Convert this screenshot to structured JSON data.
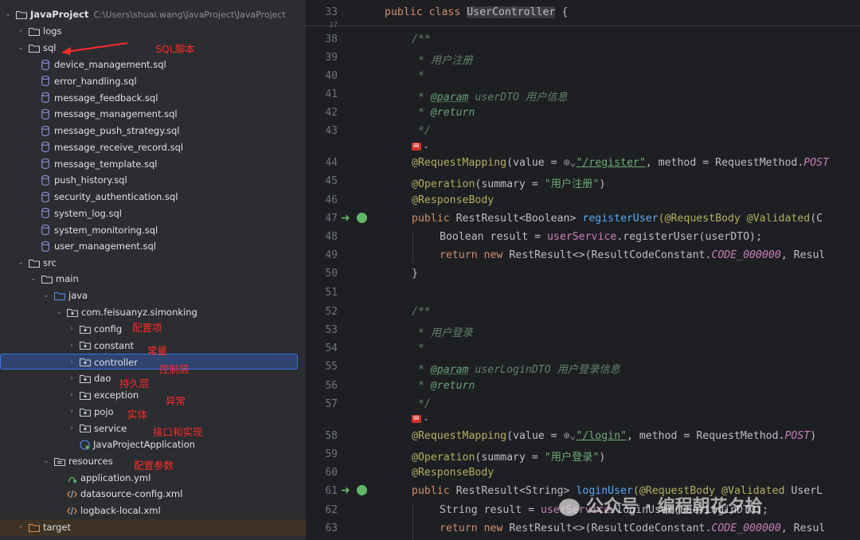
{
  "project": {
    "name": "JavaProject",
    "path": "C:\\Users\\shuai.wang\\JavaProject\\JavaProject"
  },
  "tree": {
    "logs": "logs",
    "sql": "sql",
    "sql_files": [
      "device_management.sql",
      "error_handling.sql",
      "message_feedback.sql",
      "message_management.sql",
      "message_push_strategy.sql",
      "message_receive_record.sql",
      "message_template.sql",
      "push_history.sql",
      "security_authentication.sql",
      "system_log.sql",
      "system_monitoring.sql",
      "user_management.sql"
    ],
    "src": "src",
    "main": "main",
    "java": "java",
    "package": "com.feisuanyz.simonking",
    "packages": [
      "config",
      "constant",
      "controller",
      "dao",
      "exception",
      "pojo",
      "service"
    ],
    "app_class": "JavaProjectApplication",
    "resources": "resources",
    "resource_files": [
      "application.yml",
      "datasource-config.xml",
      "logback-local.xml"
    ],
    "target": "target"
  },
  "annotations": {
    "sql": "SQL脚本",
    "config": "配置项",
    "constant": "常量",
    "controller": "控制层",
    "dao": "持久层",
    "exception": "异常",
    "pojo": "实体",
    "service": "接口和实现",
    "resources": "配置参数"
  },
  "editor": {
    "line_numbers": [
      "33",
      "37",
      "38",
      "39",
      "40",
      "41",
      "42",
      "43",
      "44",
      "45",
      "46",
      "47",
      "48",
      "49",
      "50",
      "51",
      "52",
      "53",
      "54",
      "55",
      "56",
      "57",
      "58",
      "59",
      "60",
      "61",
      "62",
      "63"
    ],
    "lines": {
      "l33": {
        "kw": "public class ",
        "name": "UserController",
        "rest": " {"
      },
      "l38": "/**",
      "l39": " * 用户注册",
      "l40": " *",
      "l41_tag": "@param",
      "l41_rest": " userDTO 用户信息",
      "l42_tag": "@return",
      "l43": " */",
      "l44_pre": "@RequestMapping",
      "l44_mid": "(value = ",
      "l44_str": "\"/register\"",
      "l44_post": ", method = RequestMethod.",
      "l44_const": "POST",
      "l45_pre": "@Operation",
      "l45_mid": "(summary = ",
      "l45_str": "\"用户注册\"",
      "l45_post": ")",
      "l46": "@ResponseBody",
      "l47_kw": "public ",
      "l47_type": "RestResult<Boolean> ",
      "l47_fn": "registerUser",
      "l47_an": "(@RequestBody @Validated",
      "l47_rest": "(C",
      "l48_pre": "Boolean result = ",
      "l48_fn": "userService",
      "l48_rest": ".registerUser(userDTO);",
      "l49_kw": "return new ",
      "l49_mid": "RestResult<>(ResultCodeConstant.",
      "l49_const": "CODE_000000",
      "l49_rest": ", Resul",
      "l50": "}",
      "l52": "/**",
      "l53": " * 用户登录",
      "l54": " *",
      "l55_tag": "@param",
      "l55_rest": " userLoginDTO 用户登录信息",
      "l56_tag": "@return",
      "l57": " */",
      "l58_pre": "@RequestMapping",
      "l58_mid": "(value = ",
      "l58_str": "\"/login\"",
      "l58_post": ", method = RequestMethod.",
      "l58_const": "POST",
      "l58_end": ")",
      "l59_pre": "@Operation",
      "l59_mid": "(summary = ",
      "l59_str": "\"用户登录\"",
      "l59_post": ")",
      "l60": "@ResponseBody",
      "l61_kw": "public ",
      "l61_type": "RestResult<String> ",
      "l61_fn": "loginUser",
      "l61_an": "(@RequestBody @Validated",
      "l61_rest": " UserL",
      "l62_pre": "String result = ",
      "l62_fn": "userService",
      "l62_rest": ".loginUser(userLoginDTO);",
      "l63_kw": "return new ",
      "l63_mid": "RestResult<>(ResultCodeConstant.",
      "l63_const": "CODE_000000",
      "l63_rest": ", Resul"
    },
    "watermark": "公众号 · 编程朝花夕拾"
  },
  "colors": {
    "selection": "#2e436e",
    "accent_red": "#ff2a2a"
  }
}
